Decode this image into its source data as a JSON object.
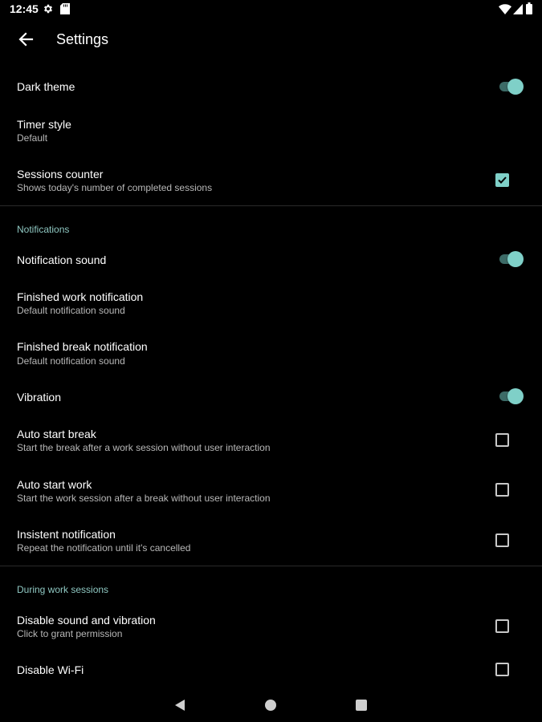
{
  "status_bar": {
    "time": "12:45",
    "left_icons": [
      "gear-icon",
      "sd-card-icon"
    ],
    "right_icons": [
      "wifi-icon",
      "signal-icon",
      "battery-icon"
    ]
  },
  "toolbar": {
    "title": "Settings",
    "back_icon": "arrow-left-icon"
  },
  "colors": {
    "accent": "#7fd0c8",
    "accent_dark": "#3c6b67",
    "background": "#000000",
    "section_header": "#8fc8c2",
    "subtitle": "#b8b8b8"
  },
  "general": {
    "dark_theme": {
      "title": "Dark theme",
      "enabled": true
    },
    "timer_style": {
      "title": "Timer style",
      "summary": "Default"
    },
    "sessions_counter": {
      "title": "Sessions counter",
      "summary": "Shows today's number of completed sessions",
      "checked": true
    }
  },
  "notifications": {
    "header": "Notifications",
    "notification_sound": {
      "title": "Notification sound",
      "enabled": true
    },
    "finished_work": {
      "title": "Finished work notification",
      "summary": "Default notification sound"
    },
    "finished_break": {
      "title": "Finished break notification",
      "summary": "Default notification sound"
    },
    "vibration": {
      "title": "Vibration",
      "enabled": true
    },
    "auto_start_break": {
      "title": "Auto start break",
      "summary": "Start the break after a work session without user interaction",
      "checked": false
    },
    "auto_start_work": {
      "title": "Auto start work",
      "summary": "Start the work session after a break without user interaction",
      "checked": false
    },
    "insistent": {
      "title": "Insistent notification",
      "summary": "Repeat the notification until it's cancelled",
      "checked": false
    }
  },
  "during_work": {
    "header": "During work sessions",
    "disable_sound": {
      "title": "Disable sound and vibration",
      "summary": "Click to grant permission",
      "checked": false
    },
    "disable_wifi": {
      "title": "Disable Wi-Fi",
      "checked": false
    }
  },
  "nav_bar": {
    "buttons": [
      "nav-back-icon",
      "nav-home-icon",
      "nav-recents-icon"
    ]
  }
}
